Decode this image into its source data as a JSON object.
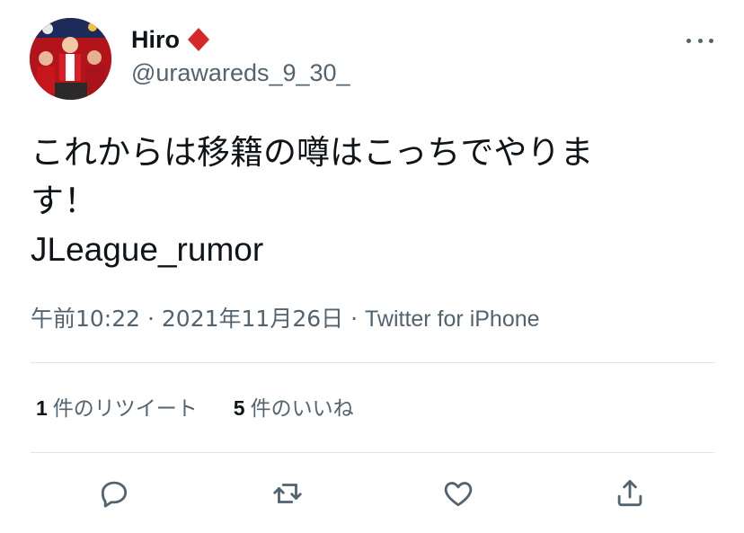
{
  "author": {
    "display_name": "Hiro",
    "handle": "@urawareds_9_30_",
    "badge_icon": "red-diamond-icon",
    "badge_color": "#d62828"
  },
  "tweet": {
    "text_line1": "これからは移籍の噂はこっちでやりま",
    "text_line1b": "す！",
    "text_line2": "JLeague_rumor"
  },
  "meta": {
    "time": "午前10:22",
    "date": "2021年11月26日",
    "source": "Twitter for iPhone",
    "separator": "·"
  },
  "stats": {
    "retweets_count": "1",
    "retweets_label": "件のリツイート",
    "likes_count": "5",
    "likes_label": "件のいいね"
  },
  "actions": [
    "reply-icon",
    "retweet-icon",
    "like-icon",
    "share-icon"
  ],
  "colors": {
    "text_primary": "#0f1419",
    "text_secondary": "#536471",
    "divider": "#e1e6ea"
  }
}
